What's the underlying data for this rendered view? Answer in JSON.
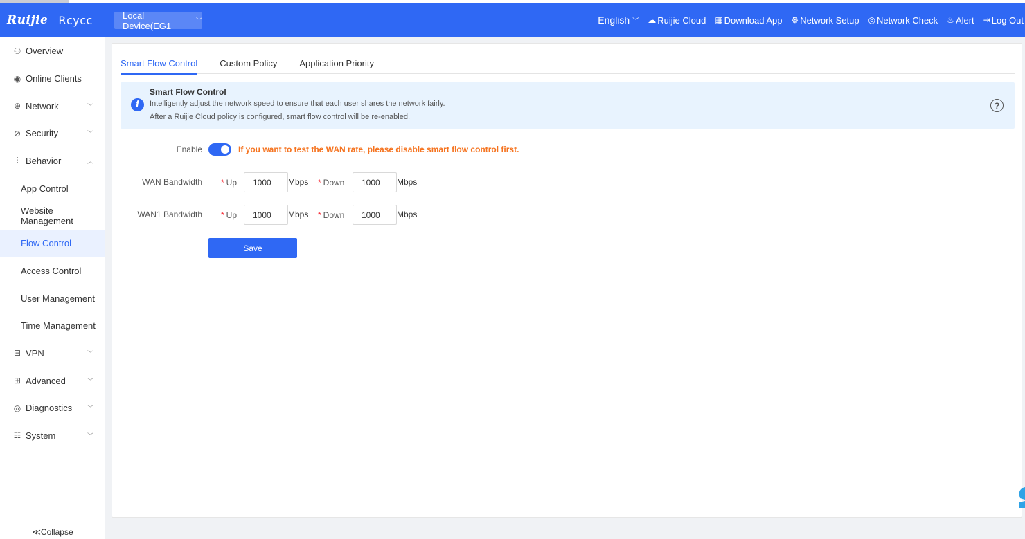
{
  "header": {
    "brand_primary": "Ruijie",
    "brand_secondary": "Rcycc",
    "device_select": "Local Device(EG1",
    "language": "English",
    "links": [
      {
        "icon": "cloud-icon",
        "glyph": "☁",
        "label": "Ruijie Cloud"
      },
      {
        "icon": "qr-code-icon",
        "glyph": "▦",
        "label": "Download App"
      },
      {
        "icon": "network-setup-icon",
        "glyph": "⚙",
        "label": "Network Setup"
      },
      {
        "icon": "network-check-icon",
        "glyph": "◎",
        "label": "Network Check"
      },
      {
        "icon": "alert-icon",
        "glyph": "♨",
        "label": "Alert"
      },
      {
        "icon": "logout-icon",
        "glyph": "⇥",
        "label": "Log Out"
      }
    ]
  },
  "sidebar": {
    "items": [
      {
        "label": "Overview",
        "icon": "overview-icon",
        "glyph": "⚇"
      },
      {
        "label": "Online Clients",
        "icon": "clients-icon",
        "glyph": "◉"
      },
      {
        "label": "Network",
        "icon": "globe-icon",
        "glyph": "⊕"
      },
      {
        "label": "Security",
        "icon": "shield-icon",
        "glyph": "⊘"
      },
      {
        "label": "Behavior",
        "icon": "behavior-icon",
        "glyph": "⫶"
      },
      {
        "label": "App Control"
      },
      {
        "label": "Website Management"
      },
      {
        "label": "Flow Control"
      },
      {
        "label": "Access Control"
      },
      {
        "label": "User Management"
      },
      {
        "label": "Time Management"
      },
      {
        "label": "VPN",
        "icon": "vpn-icon",
        "glyph": "⊟"
      },
      {
        "label": "Advanced",
        "icon": "advanced-icon",
        "glyph": "⊞"
      },
      {
        "label": "Diagnostics",
        "icon": "diagnostics-icon",
        "glyph": "◎"
      },
      {
        "label": "System",
        "icon": "system-icon",
        "glyph": "☷"
      }
    ],
    "collapse_label": "≪Collapse"
  },
  "tabs": [
    "Smart Flow Control",
    "Custom Policy",
    "Application Priority"
  ],
  "notice": {
    "title": "Smart Flow Control",
    "line1": "Intelligently adjust the network speed to ensure that each user shares the network fairly.",
    "line2": "After a Ruijie Cloud policy is configured, smart flow control will be re-enabled."
  },
  "form": {
    "enable_label": "Enable",
    "enabled": true,
    "warning": "If you want to test the WAN rate, please disable smart flow control first.",
    "rows": [
      {
        "label": "WAN Bandwidth",
        "up_label": "Up",
        "up_value": "1000",
        "down_label": "Down",
        "down_value": "1000",
        "unit": "Mbps"
      },
      {
        "label": "WAN1 Bandwidth",
        "up_label": "Up",
        "up_value": "1000",
        "down_label": "Down",
        "down_value": "1000",
        "unit": "Mbps"
      }
    ],
    "save_label": "Save"
  },
  "colors": {
    "primary": "#2f68f4",
    "warning": "#f5731f",
    "notice_bg": "#e8f3fe"
  }
}
